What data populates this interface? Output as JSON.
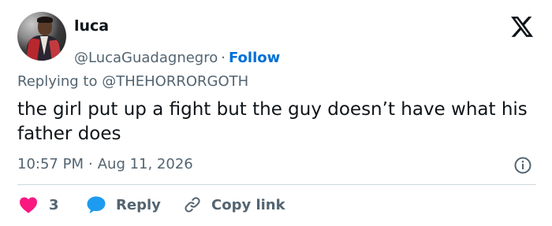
{
  "author": {
    "name": "luca",
    "handle": "@LucaGuadagnegro",
    "separator": "·",
    "follow_label": "Follow"
  },
  "brand": {
    "logo_icon": "x-logo-icon"
  },
  "reply_context": {
    "prefix": "Replying to",
    "mention": "@THEHORRORGOTH"
  },
  "tweet": {
    "text": "the girl put up a fight but the guy doesn’t have what his father does"
  },
  "meta": {
    "time": "10:57 PM",
    "separator": "·",
    "date": "Aug 11, 2026",
    "info_icon": "info-icon"
  },
  "actions": {
    "like_count": "3",
    "reply_label": "Reply",
    "copy_label": "Copy link"
  },
  "colors": {
    "accent": "#006fd6",
    "like": "#f91880",
    "reply": "#1d9bf0",
    "muted": "#536471",
    "text": "#0f1419"
  }
}
